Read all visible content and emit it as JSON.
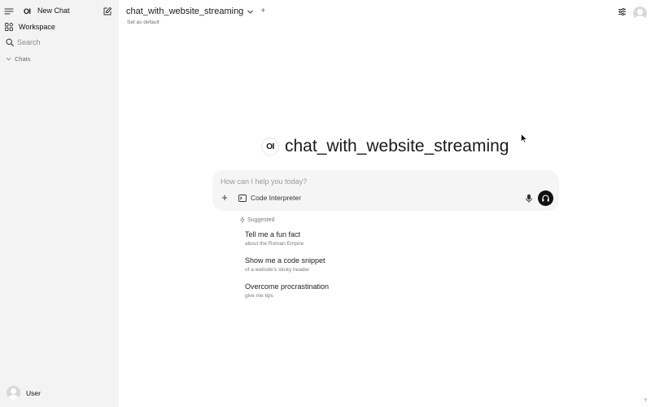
{
  "sidebar": {
    "logo_text": "OI",
    "new_chat_label": "New Chat",
    "workspace_label": "Workspace",
    "search_placeholder": "Search",
    "chats_label": "Chats",
    "user_label": "User"
  },
  "header": {
    "model_name": "chat_with_website_streaming",
    "add_model_symbol": "+",
    "set_default_label": "Set as default"
  },
  "hero": {
    "logo_text": "OI",
    "title": "chat_with_website_streaming"
  },
  "composer": {
    "placeholder": "How can I help you today?",
    "plus_symbol": "+",
    "code_interpreter_label": "Code Interpreter"
  },
  "suggestions": {
    "header_label": "Suggested",
    "items": [
      {
        "title": "Tell me a fun fact",
        "subtitle": "about the Roman Empire"
      },
      {
        "title": "Show me a code snippet",
        "subtitle": "of a website's sticky header"
      },
      {
        "title": "Overcome procrastination",
        "subtitle": "give me tips"
      }
    ]
  },
  "footer": {
    "help_label": "?"
  },
  "icons": {
    "menu": "hamburger-icon",
    "compose": "edit-icon",
    "workspace": "grid-icon",
    "search": "search-icon",
    "chevron": "chevron-down-icon",
    "controls": "sliders-icon",
    "mic": "microphone-icon",
    "voice": "headphones-icon",
    "bolt": "bolt-icon",
    "code": "terminal-icon"
  },
  "colors": {
    "sidebar_bg": "#f3f3f3",
    "composer_bg": "#f5f5f5",
    "voice_button_bg": "#111111"
  }
}
